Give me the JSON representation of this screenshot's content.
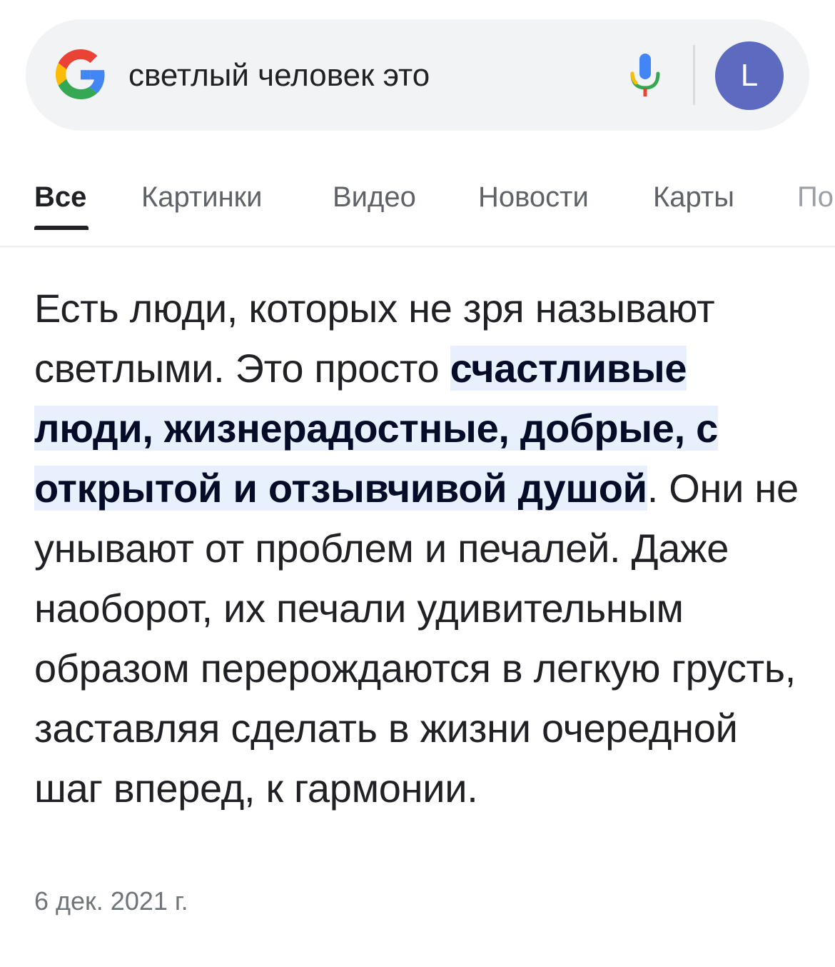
{
  "search": {
    "query": "светлый человек это",
    "avatar_letter": "L"
  },
  "tabs": [
    {
      "label": "Все",
      "active": true
    },
    {
      "label": "Картинки",
      "active": false
    },
    {
      "label": "Видео",
      "active": false
    },
    {
      "label": "Новости",
      "active": false
    },
    {
      "label": "Карты",
      "active": false
    },
    {
      "label": "По",
      "active": false
    }
  ],
  "snippet": {
    "text_before": "Есть люди, которых не зря называют светлыми. Это просто ",
    "highlight": "счастливые люди, жизнерадостные, добрые, с открытой и отзывчивой душой",
    "text_after": ". Они не унывают от проблем и печалей. Даже наоборот, их печали удивительным образом перерождаются в легкую грусть, заставляя сделать в жизни очередной шаг вперед, к гармонии.",
    "date": "6 дек. 2021 г."
  },
  "colors": {
    "search_bg": "#f1f3f4",
    "avatar_bg": "#5c6bc0",
    "highlight_bg": "#e8f0fe",
    "tab_inactive": "#5f6368",
    "date": "#70757a"
  },
  "icons": [
    "google-g-icon",
    "microphone-icon"
  ]
}
